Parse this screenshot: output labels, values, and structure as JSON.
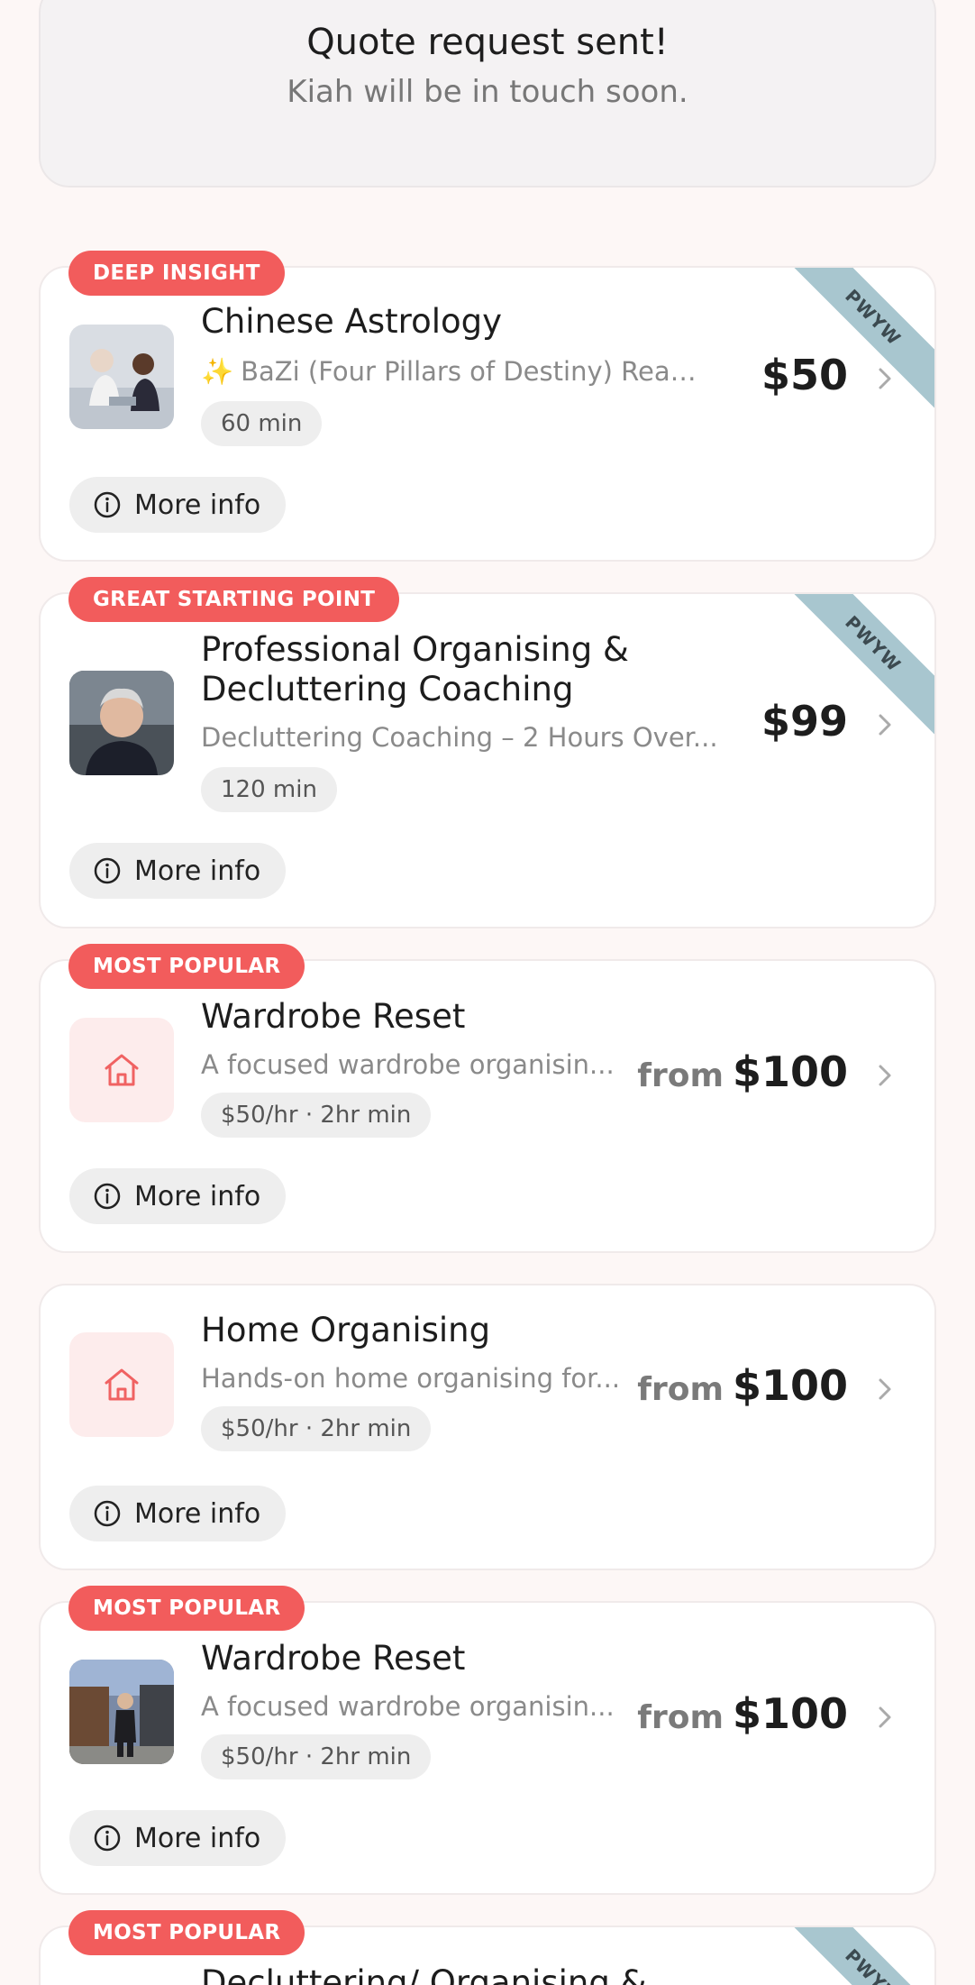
{
  "confirmation": {
    "title": "Quote request sent!",
    "subtitle": "Kiah will be in touch soon."
  },
  "cards": [
    {
      "badge": "DEEP INSIGHT",
      "title": "Chinese Astrology",
      "description": "BaZi (Four Pillars of Destiny) Readin...",
      "description_prefix_icon": "sparkles-icon",
      "duration": "60 min",
      "price": "$50",
      "ribbon": "PWYW",
      "more_info": "More info",
      "thumbnail": "photo"
    },
    {
      "badge": "GREAT STARTING POINT",
      "title_line1": "Professional Organising &",
      "title_line2": "Decluttering Coaching",
      "description": "Decluttering Coaching – 2 Hours Over...",
      "duration": "120 min",
      "price": "$99",
      "ribbon": "PWYW",
      "more_info": "More info",
      "thumbnail": "photo"
    },
    {
      "badge": "MOST POPULAR",
      "title": "Wardrobe Reset",
      "description": "A focused wardrobe organisin...",
      "duration": "$50/hr · 2hr min",
      "price_prefix": "from",
      "price": "$100",
      "more_info": "More info",
      "thumbnail": "home-icon"
    },
    {
      "title": "Home Organising",
      "description": "Hands-on home organising for...",
      "duration": "$50/hr · 2hr min",
      "price_prefix": "from",
      "price": "$100",
      "more_info": "More info",
      "thumbnail": "home-icon"
    },
    {
      "badge": "MOST POPULAR",
      "title": "Wardrobe Reset",
      "description": "A focused wardrobe organisin...",
      "duration": "$50/hr · 2hr min",
      "price_prefix": "from",
      "price": "$100",
      "more_info": "More info",
      "thumbnail": "photo"
    },
    {
      "badge": "MOST POPULAR",
      "title": "Decluttering/ Organising &",
      "ribbon": "PWYW"
    }
  ],
  "colors": {
    "accent": "#f25c5c",
    "ribbon": "#a8c6cf",
    "background": "#fdf7f6"
  }
}
